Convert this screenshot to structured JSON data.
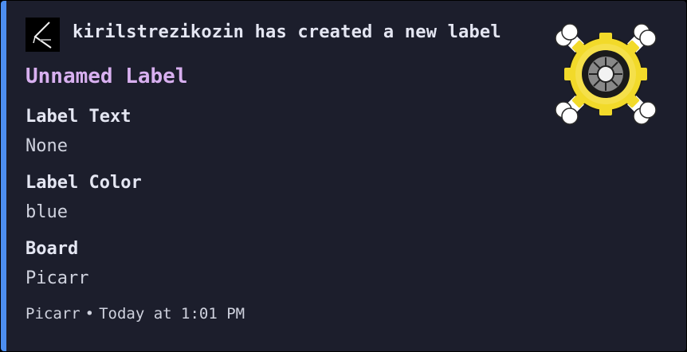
{
  "author": {
    "name": "kirilstrezikozin has created a new label",
    "avatar_icon": "app-logo-icon"
  },
  "title": "Unnamed Label",
  "fields": [
    {
      "name": "Label Text",
      "value": "None"
    },
    {
      "name": "Label Color",
      "value": "blue"
    },
    {
      "name": "Board",
      "value": "Picarr"
    }
  ],
  "footer": {
    "source": "Picarr",
    "separator": "•",
    "timestamp": "Today at 1:01 PM"
  },
  "thumbnail_icon": "gear-crossbones-icon",
  "colors": {
    "accent": "#4d8ef0",
    "background": "#1c1e2c",
    "title": "#d8b0f0",
    "gear": "#f2da2a"
  }
}
